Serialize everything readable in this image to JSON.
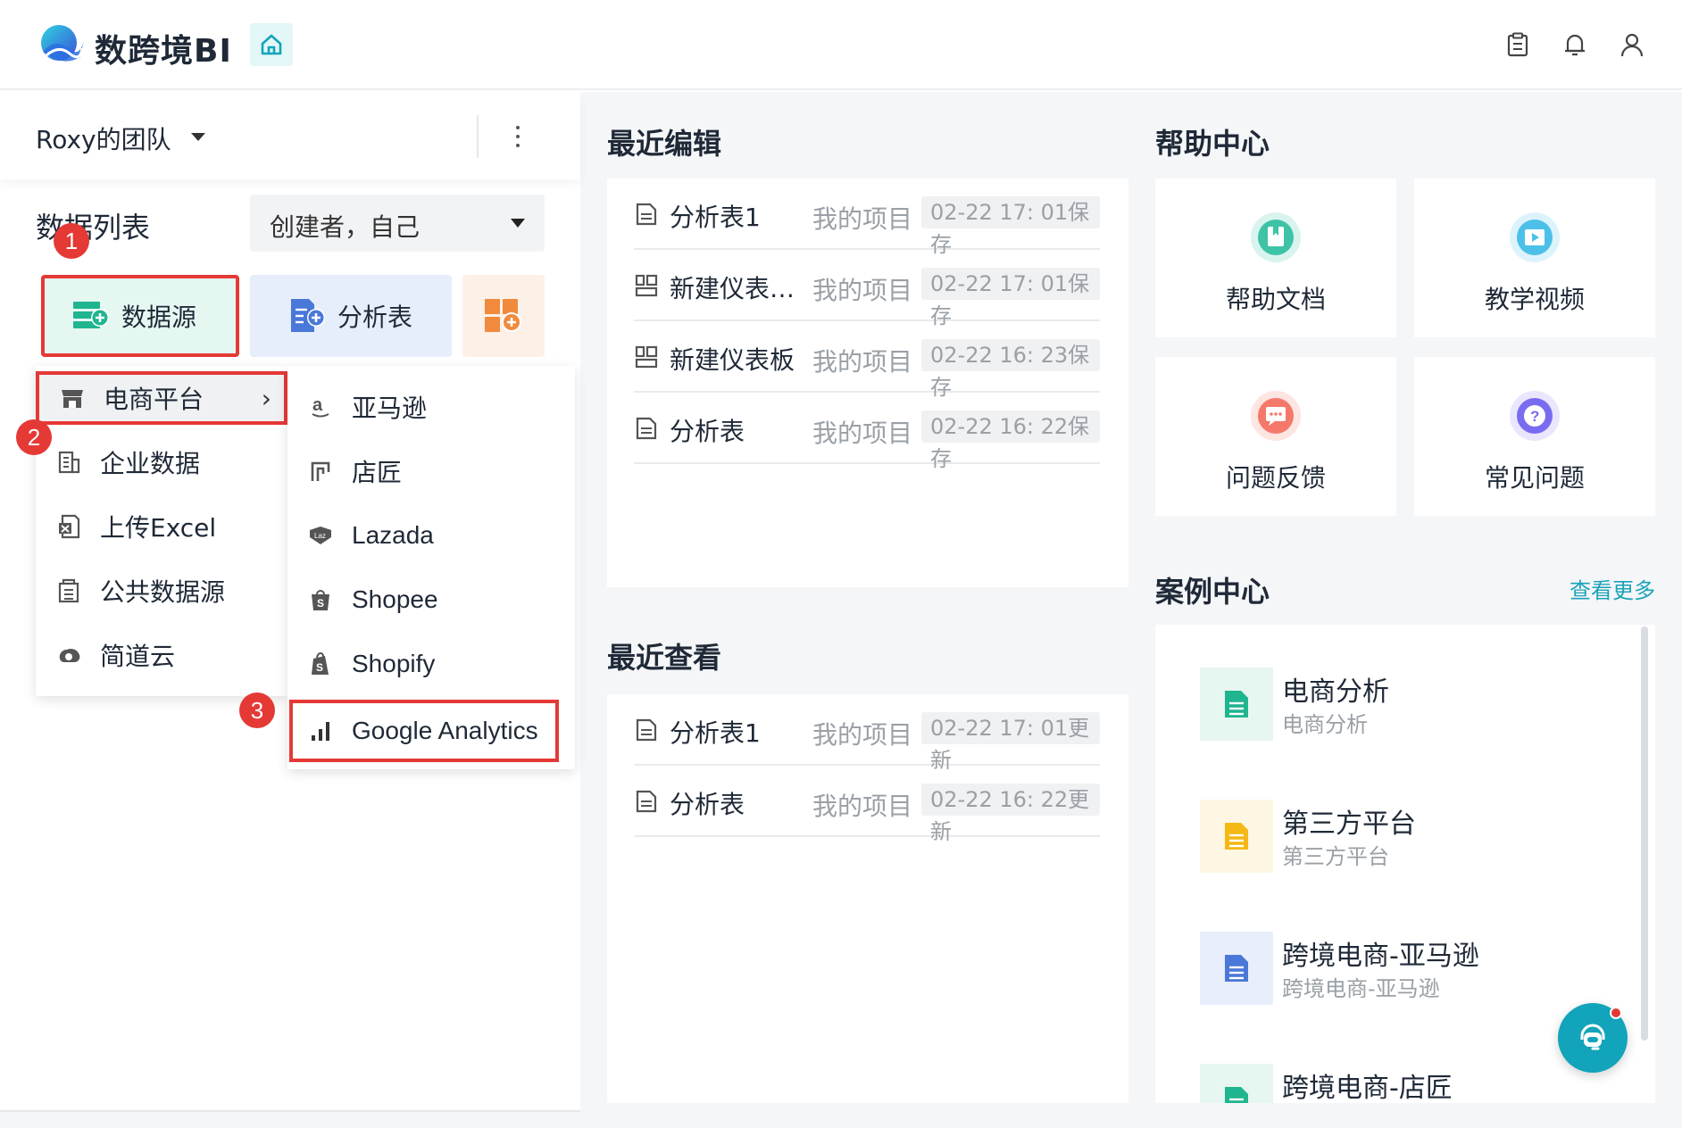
{
  "app": {
    "brand": "数跨境BI",
    "top_icons": [
      "clipboard-icon",
      "bell-icon",
      "user-icon"
    ]
  },
  "team": {
    "name": "Roxy的团队"
  },
  "data_list": {
    "title": "数据列表",
    "creator_filter": "创建者，自己",
    "buttons": {
      "datasource": "数据源",
      "analysis": "分析表"
    }
  },
  "badges": {
    "one": "1",
    "two": "2",
    "three": "3"
  },
  "menu": {
    "left": [
      {
        "label": "电商平台",
        "icon": "store-icon"
      },
      {
        "label": "企业数据",
        "icon": "building-icon"
      },
      {
        "label": "上传Excel",
        "icon": "excel-icon"
      },
      {
        "label": "公共数据源",
        "icon": "public-data-icon"
      },
      {
        "label": "简道云",
        "icon": "jiandaoyun-icon"
      }
    ],
    "right": [
      {
        "label": "亚马逊",
        "icon": "amazon-icon"
      },
      {
        "label": "店匠",
        "icon": "shoplazza-icon"
      },
      {
        "label": "Lazada",
        "icon": "lazada-icon"
      },
      {
        "label": "Shopee",
        "icon": "shopee-icon"
      },
      {
        "label": "Shopify",
        "icon": "shopify-icon"
      },
      {
        "label": "Google Analytics",
        "icon": "google-analytics-icon"
      }
    ]
  },
  "recent_edit": {
    "title": "最近编辑",
    "rows": [
      {
        "name": "分析表1",
        "project": "我的项目",
        "time": "02-22 17: 01保存",
        "icon": "analysis-doc-icon"
      },
      {
        "name": "新建仪表…",
        "project": "我的项目",
        "time": "02-22 17: 01保存",
        "icon": "dashboard-icon"
      },
      {
        "name": "新建仪表板",
        "project": "我的项目",
        "time": "02-22 16: 23保存",
        "icon": "dashboard-icon"
      },
      {
        "name": "分析表",
        "project": "我的项目",
        "time": "02-22 16: 22保存",
        "icon": "analysis-doc-icon"
      }
    ]
  },
  "recent_view": {
    "title": "最近查看",
    "rows": [
      {
        "name": "分析表1",
        "project": "我的项目",
        "time": "02-22 17: 01更新",
        "icon": "analysis-doc-icon"
      },
      {
        "name": "分析表",
        "project": "我的项目",
        "time": "02-22 16: 22更新",
        "icon": "analysis-doc-icon"
      }
    ]
  },
  "help": {
    "title": "帮助中心",
    "cards": [
      {
        "label": "帮助文档",
        "icon": "help-doc-icon",
        "color": "#3fc3a6"
      },
      {
        "label": "教学视频",
        "icon": "video-icon",
        "color": "#4cc0e8"
      },
      {
        "label": "问题反馈",
        "icon": "feedback-icon",
        "color": "#f4796b"
      },
      {
        "label": "常见问题",
        "icon": "faq-icon",
        "color": "#7a6cf0"
      }
    ]
  },
  "cases": {
    "title": "案例中心",
    "more": "查看更多",
    "items": [
      {
        "title": "电商分析",
        "sub": "电商分析",
        "color": "#1fb58f",
        "bg": "#e6f6f1"
      },
      {
        "title": "第三方平台",
        "sub": "第三方平台",
        "color": "#f5b814",
        "bg": "#fdf6e2"
      },
      {
        "title": "跨境电商-亚马逊",
        "sub": "跨境电商-亚马逊",
        "color": "#4a78d8",
        "bg": "#e8eefb"
      },
      {
        "title": "跨境电商-店匠",
        "sub": "",
        "color": "#1fb58f",
        "bg": "#e6f6f1"
      }
    ]
  },
  "colors": {
    "accent": "#12a4ba",
    "highlight_red": "#e53935"
  }
}
